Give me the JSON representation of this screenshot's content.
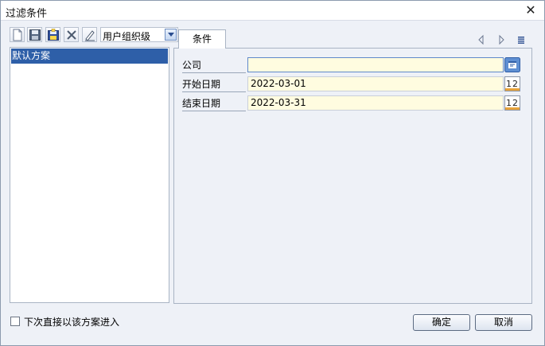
{
  "window": {
    "title": "过滤条件",
    "close_icon": "close-icon"
  },
  "toolbar": {
    "icons": [
      "new-file-icon",
      "save-icon",
      "save-as-icon",
      "delete-icon",
      "edit-icon"
    ],
    "scope_value": "用户组织级"
  },
  "plans": {
    "items": [
      {
        "label": "默认方案",
        "selected": true
      }
    ]
  },
  "tabs": [
    {
      "label": "条件"
    }
  ],
  "fields": [
    {
      "label": "公司",
      "value": "",
      "button_icon": "lookup-icon"
    },
    {
      "label": "开始日期",
      "value": "2022-03-01",
      "button_icon": "calendar-icon"
    },
    {
      "label": "结束日期",
      "value": "2022-03-31",
      "button_icon": "calendar-icon"
    }
  ],
  "footer": {
    "checkbox_label": "下次直接以该方案进入",
    "checkbox_checked": false,
    "ok_label": "确定",
    "cancel_label": "取消"
  },
  "colors": {
    "selection": "#2e5fa8",
    "field_bg": "#fffce0",
    "window_bg": "#eef1f7"
  }
}
